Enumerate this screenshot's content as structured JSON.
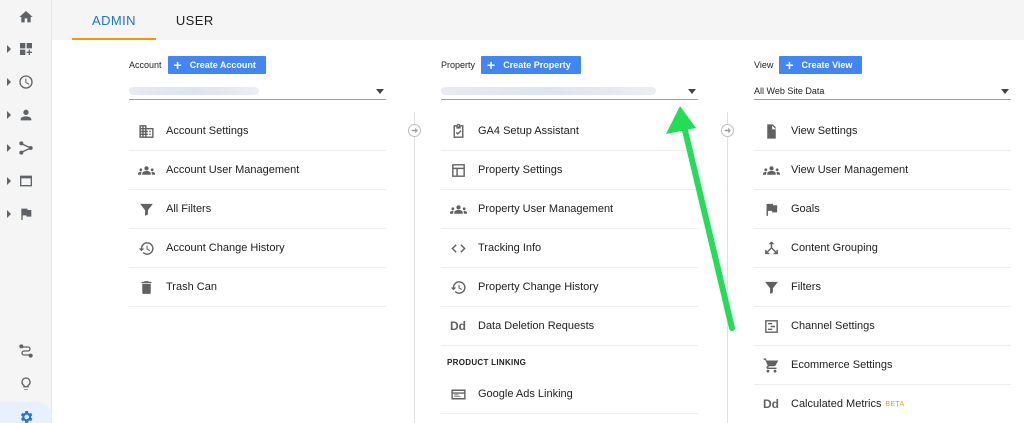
{
  "tabs": {
    "admin": "ADMIN",
    "user": "USER"
  },
  "account": {
    "label": "Account",
    "create_label": "Create Account",
    "menu": [
      {
        "label": "Account Settings",
        "icon": "building-icon"
      },
      {
        "label": "Account User Management",
        "icon": "people-icon"
      },
      {
        "label": "All Filters",
        "icon": "filter-icon"
      },
      {
        "label": "Account Change History",
        "icon": "history-icon"
      },
      {
        "label": "Trash Can",
        "icon": "trash-icon"
      }
    ]
  },
  "property": {
    "label": "Property",
    "create_label": "Create Property",
    "menu": [
      {
        "label": "GA4 Setup Assistant",
        "icon": "checklist-icon"
      },
      {
        "label": "Property Settings",
        "icon": "layout-icon"
      },
      {
        "label": "Property User Management",
        "icon": "people-icon"
      },
      {
        "label": "Tracking Info",
        "icon": "code-icon"
      },
      {
        "label": "Property Change History",
        "icon": "history-icon"
      },
      {
        "label": "Data Deletion Requests",
        "icon": "dd-icon",
        "glyph": "Dd"
      }
    ],
    "section_title": "PRODUCT LINKING",
    "linking": [
      {
        "label": "Google Ads Linking",
        "icon": "ads-icon"
      }
    ]
  },
  "view": {
    "label": "View",
    "create_label": "Create View",
    "selected": "All Web Site Data",
    "menu": [
      {
        "label": "View Settings",
        "icon": "document-icon"
      },
      {
        "label": "View User Management",
        "icon": "people-icon"
      },
      {
        "label": "Goals",
        "icon": "flag-icon"
      },
      {
        "label": "Content Grouping",
        "icon": "grouping-icon"
      },
      {
        "label": "Filters",
        "icon": "filter-icon"
      },
      {
        "label": "Channel Settings",
        "icon": "channel-icon"
      },
      {
        "label": "Ecommerce Settings",
        "icon": "cart-icon"
      },
      {
        "label": "Calculated Metrics",
        "icon": "dd-icon",
        "glyph": "Dd",
        "badge": "BETA"
      }
    ]
  },
  "colors": {
    "accent": "#1a73e8",
    "button": "#4285f4",
    "tab_underline": "#f29900",
    "annotation": "#22dd55"
  }
}
